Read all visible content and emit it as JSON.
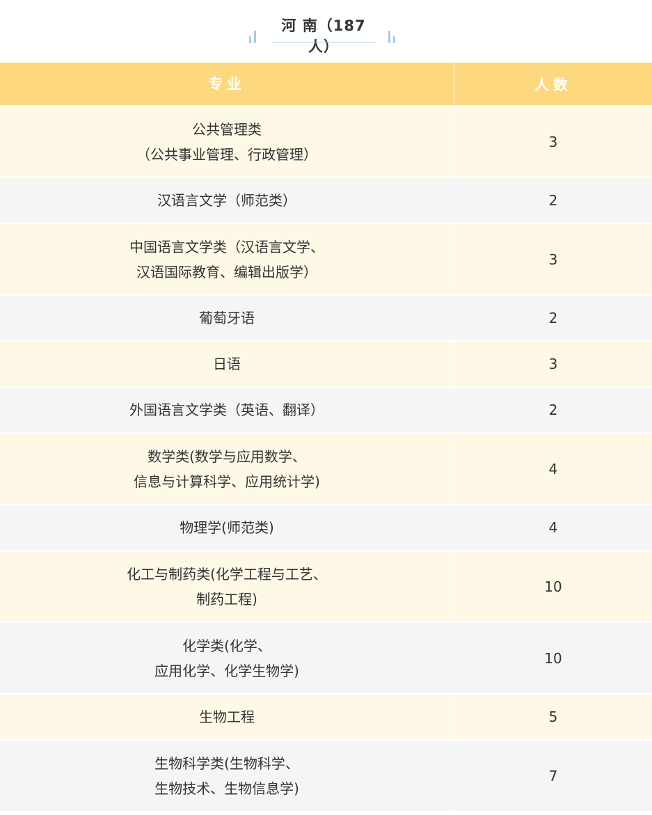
{
  "title": "河 南（187人）",
  "table": {
    "headers": {
      "major": "专业",
      "count": "人数"
    },
    "rows": [
      {
        "lines": [
          "公共管理类",
          "（公共事业管理、行政管理）"
        ],
        "count": "3"
      },
      {
        "lines": [
          "汉语言文学（师范类）"
        ],
        "count": "2"
      },
      {
        "lines": [
          "中国语言文学类（汉语言文学、",
          "汉语国际教育、编辑出版学）"
        ],
        "count": "3"
      },
      {
        "lines": [
          "葡萄牙语"
        ],
        "count": "2"
      },
      {
        "lines": [
          "日语"
        ],
        "count": "3"
      },
      {
        "lines": [
          "外国语言文学类（英语、翻译）"
        ],
        "count": "2"
      },
      {
        "lines": [
          "数学类(数学与应用数学、",
          "信息与计算科学、应用统计学)"
        ],
        "count": "4"
      },
      {
        "lines": [
          "物理学(师范类)"
        ],
        "count": "4"
      },
      {
        "lines": [
          "化工与制药类(化学工程与工艺、",
          "制药工程)"
        ],
        "count": "10"
      },
      {
        "lines": [
          "化学类(化学、",
          "应用化学、化学生物学)"
        ],
        "count": "10"
      },
      {
        "lines": [
          "生物工程"
        ],
        "count": "5"
      },
      {
        "lines": [
          "生物科学类(生物科学、",
          "生物技术、生物信息学)"
        ],
        "count": "7"
      }
    ]
  },
  "colors": {
    "header_bg": "#fdd87e",
    "row_odd_bg": "#fef8e7",
    "row_even_bg": "#f5f5f5",
    "accent_blue": "#a9cbe3"
  }
}
